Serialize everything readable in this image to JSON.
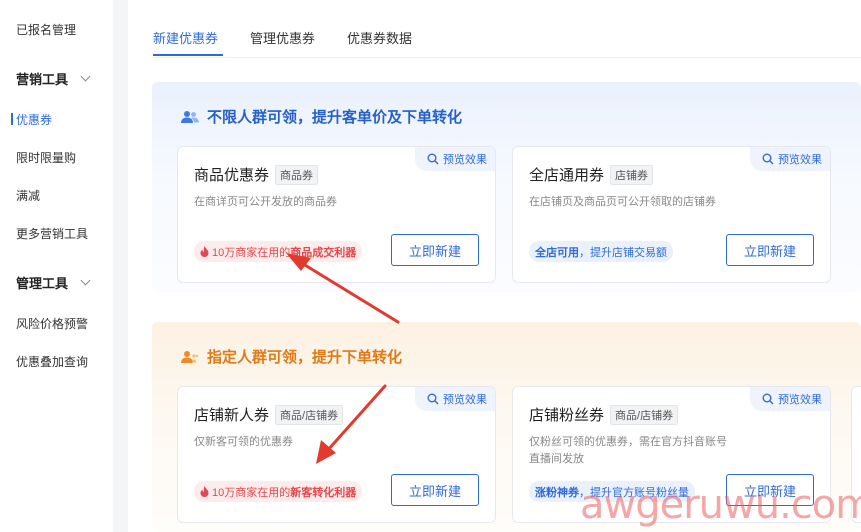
{
  "sidebar": {
    "items": [
      {
        "label": "已报名管理"
      },
      {
        "label": "营销工具"
      },
      {
        "label": "优惠券"
      },
      {
        "label": "限时限量购"
      },
      {
        "label": "满减"
      },
      {
        "label": "更多营销工具"
      },
      {
        "label": "管理工具"
      },
      {
        "label": "风险价格预警"
      },
      {
        "label": "优惠叠加查询"
      }
    ]
  },
  "tabs": [
    {
      "label": "新建优惠券",
      "active": true
    },
    {
      "label": "管理优惠券"
    },
    {
      "label": "优惠券数据"
    }
  ],
  "sections": [
    {
      "title": "不限人群可领，提升客单价及下单转化",
      "cards": [
        {
          "title": "商品优惠券",
          "tag": "商品券",
          "preview": "预览效果",
          "desc": "在商详页可公开发放的商品券",
          "badge_prefix": "10万商家在用的",
          "badge_bold": "商品成交利器",
          "button": "立即新建"
        },
        {
          "title": "全店通用券",
          "tag": "店铺券",
          "preview": "预览效果",
          "desc": "在店铺页及商品页可公开领取的店铺券",
          "badge_prefix": "全店可用",
          "badge_bold": "，提升店铺交易额",
          "button": "立即新建"
        }
      ]
    },
    {
      "title": "指定人群可领，提升下单转化",
      "cards": [
        {
          "title": "店铺新人券",
          "tag": "商品/店铺券",
          "preview": "预览效果",
          "desc": "仅新客可领的优惠券",
          "badge_prefix": "10万商家在用的",
          "badge_bold": "新客转化利器",
          "button": "立即新建"
        },
        {
          "title": "店铺粉丝券",
          "tag": "商品/店铺券",
          "preview": "预览效果",
          "desc": "仅粉丝可领的优惠券，需在官方抖音账号直播间发放",
          "badge_prefix": "涨粉神券",
          "badge_bold": "，提升官方账号粉丝量",
          "button": "立即新建"
        }
      ]
    }
  ],
  "watermark": "awgeruwu.com",
  "colors": {
    "accent": "#2f6bd8",
    "orange": "#e07a16",
    "red": "#e5484d",
    "arrow": "#e23b2e"
  }
}
